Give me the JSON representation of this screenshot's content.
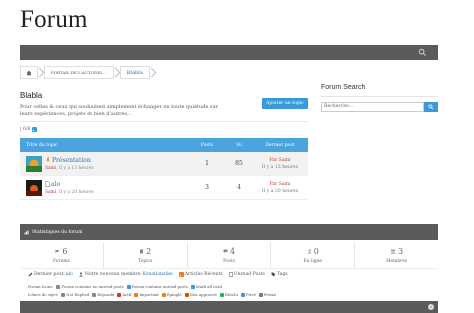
{
  "site": {
    "title": "Forum"
  },
  "breadcrumb": {
    "portal": "PORTAIL DE L'AUTODEL...",
    "current": "Blabla"
  },
  "forum": {
    "name": "Blabla",
    "description": "Pour celles & ceux qui souhaitent simplement échanger en toute quiétude sur leurs expériences, projets et bien d'autres…",
    "new_topic_label": "Ajouter un topic",
    "pager": "| 6/6"
  },
  "topics": {
    "headers": {
      "title": "Titre du topic",
      "posts": "Posts",
      "views": "Vu",
      "last": "Dernier post"
    },
    "rows": [
      {
        "name": "Présentation",
        "author": "Sami",
        "time": "Il y a 13 heures",
        "posts": "1",
        "views": "85",
        "last_by": "Par Sami",
        "last_time": "Il y a 13 heures",
        "colors": {
          "sky": "#3aa0c8",
          "sun": "#f0a020",
          "ground": "#2e7d32"
        }
      },
      {
        "name": "alo",
        "author": "Sami",
        "time": "Il y a 20 heures",
        "posts": "3",
        "views": "4",
        "last_by": "Par Sami",
        "last_time": "Il y a 20 heures",
        "colors": {
          "sky": "#1a1a1a",
          "sun": "#e05a1a",
          "ground": "#5a1a0a"
        }
      }
    ]
  },
  "sidebar": {
    "title": "Forum Search",
    "search_placeholder": "Recherche..."
  },
  "stats": {
    "title": "Statistiques du forum",
    "items": [
      {
        "num": "6",
        "label": "Forums",
        "icon": "comments-icon"
      },
      {
        "num": "2",
        "label": "Topics",
        "icon": "file-icon"
      },
      {
        "num": "4",
        "label": "Posts",
        "icon": "comment-icon"
      },
      {
        "num": "0",
        "label": "En ligne",
        "icon": "user-icon"
      },
      {
        "num": "3",
        "label": "Membres",
        "icon": "users-icon"
      }
    ]
  },
  "links": {
    "last_post_label": "Dernier post:",
    "last_post_value": "alo",
    "newest_member_label": "Notre nouveau membre:",
    "newest_member_value": "Kreationsfan",
    "recent_articles": "Articles Récents",
    "unread_posts": "Unread Posts",
    "tags": "Tags"
  },
  "legend1": [
    {
      "label": "Forum Icons:"
    },
    {
      "label": "Forum contains no unread posts",
      "color": "#888888"
    },
    {
      "label": "Forum contains unread posts",
      "color": "#3a9ad9"
    },
    {
      "label": "Mark all read",
      "color": "#3a9ad9"
    }
  ],
  "legend2": [
    {
      "label": "Icônes de sujet:"
    },
    {
      "label": "Not Replied",
      "color": "#888888"
    },
    {
      "label": "Répondu",
      "color": "#888888"
    },
    {
      "label": "Actif",
      "color": "#c0392b"
    },
    {
      "label": "Important",
      "color": "#e67e22"
    },
    {
      "label": "Épinglé",
      "color": "#e67e22"
    },
    {
      "label": "Non approuvé",
      "color": "#d35400"
    },
    {
      "label": "Résolu",
      "color": "#27ae60"
    },
    {
      "label": "Privé",
      "color": "#3a9ad9"
    },
    {
      "label": "Fermé",
      "color": "#777777"
    }
  ],
  "colors": {
    "accent": "#3a9ad9",
    "bar": "#5a5a5a",
    "link": "#2a6fb0",
    "author": "#c0392b"
  }
}
